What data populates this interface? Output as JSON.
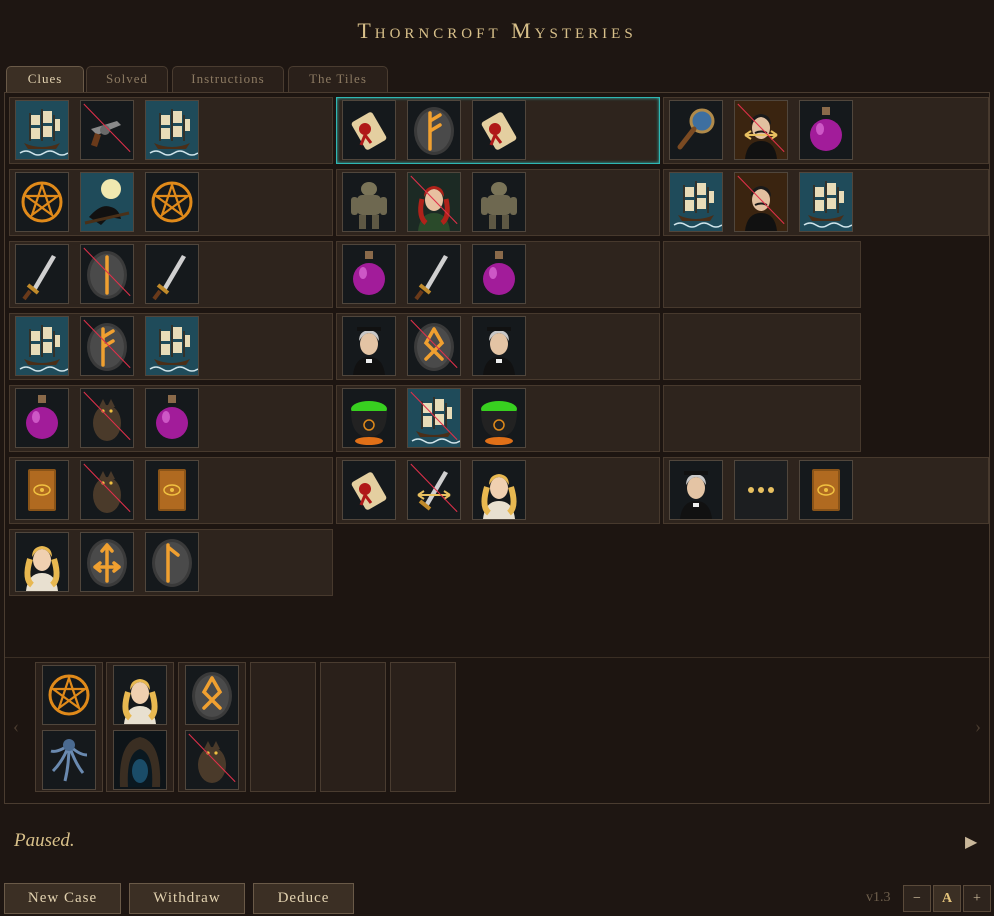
{
  "title": "Thorncroft Mysteries",
  "tabs": [
    "Clues",
    "Solved",
    "Instructions",
    "The Tiles"
  ],
  "active_tab": "Clues",
  "clues": [
    {
      "tiles": [
        "ship",
        "revolver",
        "ship"
      ],
      "negated": [
        1
      ],
      "selected": false
    },
    {
      "tiles": [
        "scroll",
        "rune-f",
        "scroll"
      ],
      "negated": [],
      "selected": true
    },
    {
      "tiles": [
        "magnifier",
        "man-mustache-arrows",
        "potion"
      ],
      "negated": [
        1
      ],
      "selected": false
    },
    {
      "tiles": [
        "pentacle",
        "raven-moon",
        "pentacle"
      ],
      "negated": [],
      "selected": false
    },
    {
      "tiles": [
        "golem",
        "red-haired-woman",
        "golem"
      ],
      "negated": [
        1
      ],
      "selected": false
    },
    {
      "tiles": [
        "ship",
        "man-mustache",
        "ship"
      ],
      "negated": [
        1
      ],
      "selected": false
    },
    {
      "tiles": [
        "dagger",
        "rune-i",
        "dagger"
      ],
      "negated": [
        1
      ],
      "selected": false
    },
    {
      "tiles": [
        "potion",
        "dagger",
        "potion"
      ],
      "negated": [],
      "selected": false
    },
    {
      "tiles": [],
      "negated": [],
      "selected": false
    },
    {
      "tiles": [
        "ship",
        "rune-f",
        "ship"
      ],
      "negated": [
        1
      ],
      "selected": false
    },
    {
      "tiles": [
        "priest",
        "rune-o",
        "priest"
      ],
      "negated": [
        1
      ],
      "selected": false
    },
    {
      "tiles": [],
      "negated": [],
      "selected": false
    },
    {
      "tiles": [
        "potion",
        "werewolf",
        "potion"
      ],
      "negated": [
        1
      ],
      "selected": false
    },
    {
      "tiles": [
        "cauldron",
        "ship",
        "cauldron"
      ],
      "negated": [
        1
      ],
      "selected": false
    },
    {
      "tiles": [],
      "negated": [],
      "selected": false
    },
    {
      "tiles": [
        "tome",
        "werewolf",
        "tome"
      ],
      "negated": [
        1
      ],
      "selected": false
    },
    {
      "tiles": [
        "scroll",
        "dagger-arrows",
        "blonde-woman"
      ],
      "negated": [
        1
      ],
      "selected": false
    },
    {
      "tiles": [
        "priest",
        "ellipsis",
        "tome"
      ],
      "negated": [],
      "selected": false
    },
    {
      "tiles": [
        "blonde-woman",
        "rune-arrows",
        "rune-l"
      ],
      "negated": [],
      "selected": false
    }
  ],
  "hand": [
    {
      "tiles": [
        "pentacle",
        "tentacles"
      ],
      "negated": []
    },
    {
      "tiles": [
        "blonde-woman",
        "cave"
      ],
      "negated": []
    },
    {
      "tiles": [
        "rune-o",
        "werewolf"
      ],
      "negated": [
        1
      ]
    },
    {
      "tiles": [],
      "negated": []
    },
    {
      "tiles": [],
      "negated": []
    },
    {
      "tiles": [],
      "negated": []
    }
  ],
  "nav": {
    "prev": "‹",
    "next": "›"
  },
  "status": "Paused.",
  "play_icon": "▶",
  "buttons": {
    "new_case": "New Case",
    "withdraw": "Withdraw",
    "deduce": "Deduce"
  },
  "version": "v1.3",
  "zoom": {
    "minus": "−",
    "reset": "A",
    "plus": "+"
  },
  "colors": {
    "accent": "#d8c08a",
    "selected_border": "#2fb7b3",
    "negation_line": "#e0304a",
    "rune_glow": "#f0a030"
  }
}
